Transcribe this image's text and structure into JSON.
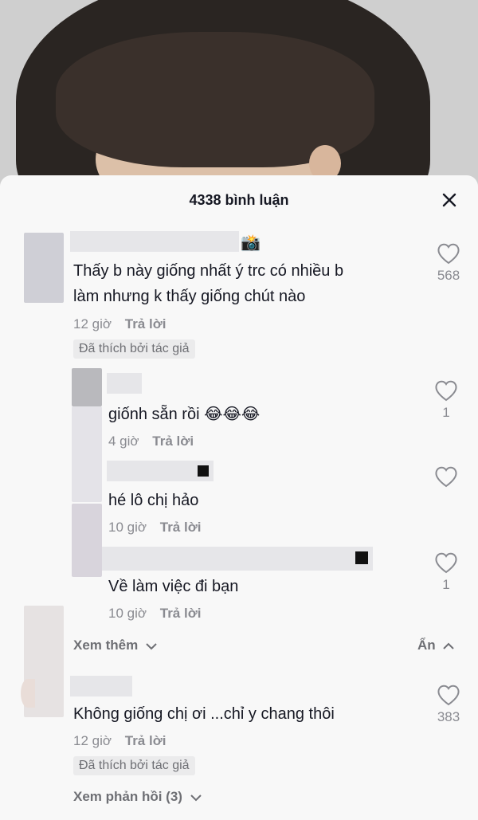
{
  "header": {
    "title": "4338 bình luận"
  },
  "comments": [
    {
      "text_lines": [
        "Thấy b này giống nhất ý trc có nhiều b",
        "làm nhưng k thấy giống chút nào"
      ],
      "time": "12 giờ",
      "reply_label": "Trả lời",
      "badge": "Đã thích bởi tác giả",
      "likes": "568",
      "name_decoration": "📸"
    },
    {
      "text_lines": [
        "Không giống chị ơi ...chỉ y chang thôi"
      ],
      "time": "12 giờ",
      "reply_label": "Trả lời",
      "badge": "Đã thích bởi tác giả",
      "likes": "383"
    }
  ],
  "replies": [
    {
      "text": "giốnh sẵn rồi",
      "emojis": "😂😂😂",
      "time": "4 giờ",
      "reply_label": "Trả lời",
      "likes": "1"
    },
    {
      "text": "hé lô chị hảo",
      "time": "10 giờ",
      "reply_label": "Trả lời",
      "likes": ""
    },
    {
      "text": "Về làm việc đi bạn",
      "time": "10 giờ",
      "reply_label": "Trả lời",
      "likes": "1"
    }
  ],
  "links": {
    "see_more": "Xem thêm",
    "hide": "Ẩn",
    "see_replies": "Xem phản hồi (3)"
  },
  "colors": {
    "sheet_bg": "#f8f8f8",
    "text": "#161823",
    "meta": "#8a8b91"
  }
}
